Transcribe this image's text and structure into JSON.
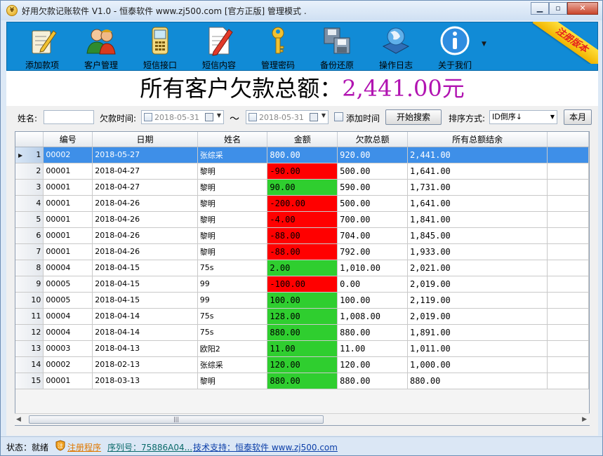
{
  "window": {
    "title": "好用欠款记账软件 V1.0 - 恒泰软件   www.zj500.com [官方正版]   管理模式  ."
  },
  "toolbar": {
    "items": [
      {
        "label": "添加款项",
        "icon": "edit-note-icon"
      },
      {
        "label": "客户管理",
        "icon": "customers-icon"
      },
      {
        "label": "短信接口",
        "icon": "phone-icon"
      },
      {
        "label": "短信内容",
        "icon": "document-pen-icon"
      },
      {
        "label": "管理密码",
        "icon": "key-icon"
      },
      {
        "label": "备份还原",
        "icon": "backup-disk-icon"
      },
      {
        "label": "操作日志",
        "icon": "globe-log-icon"
      },
      {
        "label": "关于我们",
        "icon": "info-icon"
      }
    ],
    "ribbon_text": "注册版本"
  },
  "banner": {
    "label": "所有客户欠款总额：",
    "amount": "2,441.00元",
    "label_color": "#000000",
    "amount_color": "#b113b1"
  },
  "filters": {
    "name_label": "姓名:",
    "name_value": "",
    "debt_time_label": "欠款时间:",
    "date_from": "2018-05-31",
    "tilde": "～",
    "date_to": "2018-05-31",
    "add_time_label": "添加时间",
    "search_button": "开始搜索",
    "sort_label": "排序方式:",
    "sort_value": "ID倒序↓",
    "month_button": "本月"
  },
  "grid": {
    "columns": [
      "",
      "编号",
      "日期",
      "姓名",
      "金额",
      "欠款总额",
      "所有总额结余"
    ],
    "rows": [
      {
        "n": "1",
        "id": "00002",
        "date": "2018-05-27",
        "name": "张综采",
        "amount": "800.00",
        "total": "920.00",
        "balance": "2,441.00",
        "amount_color": "selected"
      },
      {
        "n": "2",
        "id": "00001",
        "date": "2018-04-27",
        "name": "黎明",
        "amount": "-90.00",
        "total": "500.00",
        "balance": "1,641.00",
        "amount_color": "red"
      },
      {
        "n": "3",
        "id": "00001",
        "date": "2018-04-27",
        "name": "黎明",
        "amount": "90.00",
        "total": "590.00",
        "balance": "1,731.00",
        "amount_color": "green"
      },
      {
        "n": "4",
        "id": "00001",
        "date": "2018-04-26",
        "name": "黎明",
        "amount": "-200.00",
        "total": "500.00",
        "balance": "1,641.00",
        "amount_color": "red"
      },
      {
        "n": "5",
        "id": "00001",
        "date": "2018-04-26",
        "name": "黎明",
        "amount": "-4.00",
        "total": "700.00",
        "balance": "1,841.00",
        "amount_color": "red"
      },
      {
        "n": "6",
        "id": "00001",
        "date": "2018-04-26",
        "name": "黎明",
        "amount": "-88.00",
        "total": "704.00",
        "balance": "1,845.00",
        "amount_color": "red"
      },
      {
        "n": "7",
        "id": "00001",
        "date": "2018-04-26",
        "name": "黎明",
        "amount": "-88.00",
        "total": "792.00",
        "balance": "1,933.00",
        "amount_color": "red"
      },
      {
        "n": "8",
        "id": "00004",
        "date": "2018-04-15",
        "name": "75s",
        "amount": "2.00",
        "total": "1,010.00",
        "balance": "2,021.00",
        "amount_color": "green"
      },
      {
        "n": "9",
        "id": "00005",
        "date": "2018-04-15",
        "name": "99",
        "amount": "-100.00",
        "total": "0.00",
        "balance": "2,019.00",
        "amount_color": "red"
      },
      {
        "n": "10",
        "id": "00005",
        "date": "2018-04-15",
        "name": "99",
        "amount": "100.00",
        "total": "100.00",
        "balance": "2,119.00",
        "amount_color": "green"
      },
      {
        "n": "11",
        "id": "00004",
        "date": "2018-04-14",
        "name": "75s",
        "amount": "128.00",
        "total": "1,008.00",
        "balance": "2,019.00",
        "amount_color": "green"
      },
      {
        "n": "12",
        "id": "00004",
        "date": "2018-04-14",
        "name": "75s",
        "amount": "880.00",
        "total": "880.00",
        "balance": "1,891.00",
        "amount_color": "green"
      },
      {
        "n": "13",
        "id": "00003",
        "date": "2018-04-13",
        "name": "欧阳2",
        "amount": "11.00",
        "total": "11.00",
        "balance": "1,011.00",
        "amount_color": "green"
      },
      {
        "n": "14",
        "id": "00002",
        "date": "2018-02-13",
        "name": "张综采",
        "amount": "120.00",
        "total": "120.00",
        "balance": "1,000.00",
        "amount_color": "green"
      },
      {
        "n": "15",
        "id": "00001",
        "date": "2018-03-13",
        "name": "黎明",
        "amount": "880.00",
        "total": "880.00",
        "balance": "880.00",
        "amount_color": "green"
      }
    ],
    "selected_row": 1
  },
  "statusbar": {
    "state": "状态：就绪",
    "register": "注册程序",
    "serial": "序列号：75886A04...",
    "support": "技术支持：恒泰软件  www.zj500.com"
  },
  "colors": {
    "toolbar_bg": "#118bd6",
    "negative_cell": "#ff0000",
    "positive_cell": "#2fce2f",
    "selection": "#3e8fe8"
  }
}
